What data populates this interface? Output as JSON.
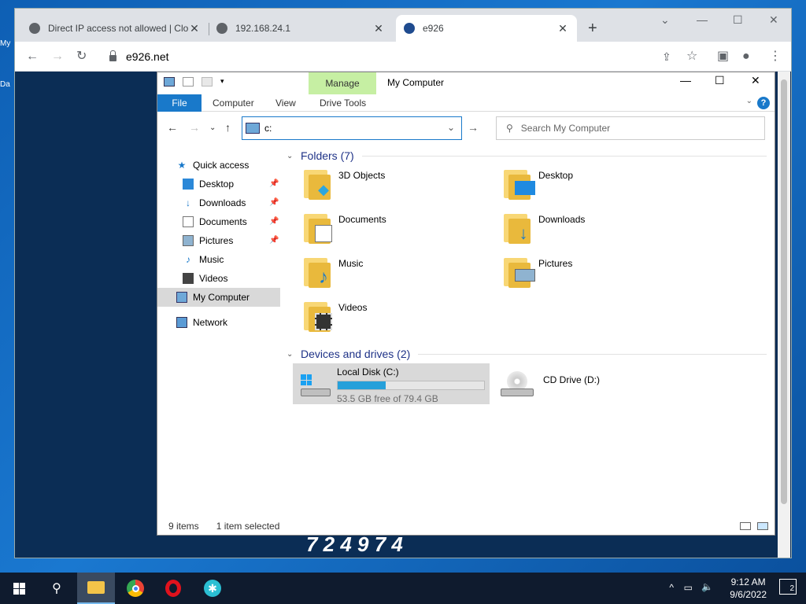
{
  "browser": {
    "tabs": [
      {
        "title": "Direct IP access not allowed | Clo"
      },
      {
        "title": "192.168.24.1"
      },
      {
        "title": "e926"
      }
    ],
    "url": "e926.net"
  },
  "explorer": {
    "manage_label": "Manage",
    "title": "My Computer",
    "ribbon_tabs": [
      "File",
      "Computer",
      "View",
      "Drive Tools"
    ],
    "address_value": "c:",
    "search_placeholder": "Search My Computer",
    "nav": [
      {
        "label": "Quick access",
        "icon": "star-icon"
      },
      {
        "label": "Desktop",
        "icon": "desktop-icon",
        "pinned": true
      },
      {
        "label": "Downloads",
        "icon": "download-arrow-icon",
        "pinned": true
      },
      {
        "label": "Documents",
        "icon": "document-icon",
        "pinned": true
      },
      {
        "label": "Pictures",
        "icon": "pictures-icon",
        "pinned": true
      },
      {
        "label": "Music",
        "icon": "music-note-icon"
      },
      {
        "label": "Videos",
        "icon": "film-icon"
      },
      {
        "label": "My Computer",
        "icon": "computer-icon",
        "selected": true
      },
      {
        "label": "Network",
        "icon": "network-icon"
      }
    ],
    "folders_header": "Folders (7)",
    "folders": [
      {
        "name": "3D Objects",
        "icon": "cube-icon"
      },
      {
        "name": "Desktop",
        "icon": "desktop-icon"
      },
      {
        "name": "Documents",
        "icon": "document-icon"
      },
      {
        "name": "Downloads",
        "icon": "download-arrow-icon"
      },
      {
        "name": "Music",
        "icon": "music-note-icon"
      },
      {
        "name": "Pictures",
        "icon": "pictures-icon"
      },
      {
        "name": "Videos",
        "icon": "film-icon"
      }
    ],
    "drives_header": "Devices and drives (2)",
    "drives": [
      {
        "name": "Local Disk (C:)",
        "free": "53.5 GB free of 79.4 GB",
        "used_fraction": 0.326,
        "icon": "hard-disk-icon"
      },
      {
        "name": "CD Drive (D:)",
        "icon": "cd-drive-icon"
      }
    ],
    "status_items": "9 items",
    "status_selected": "1 item selected"
  },
  "page_numbers": "7 2 4 9 7 4",
  "taskbar": {
    "time": "9:12 AM",
    "date": "9/6/2022",
    "notifications": "2",
    "apps": [
      "start-icon",
      "search-icon",
      "file-explorer-icon",
      "chrome-icon",
      "opera-icon",
      "accessibility-app-icon"
    ]
  },
  "colors": {
    "accent": "#1979ca",
    "manage_tab": "#c6efa3",
    "desktop": "#1a78d0",
    "page_bg": "#0b2d55"
  }
}
